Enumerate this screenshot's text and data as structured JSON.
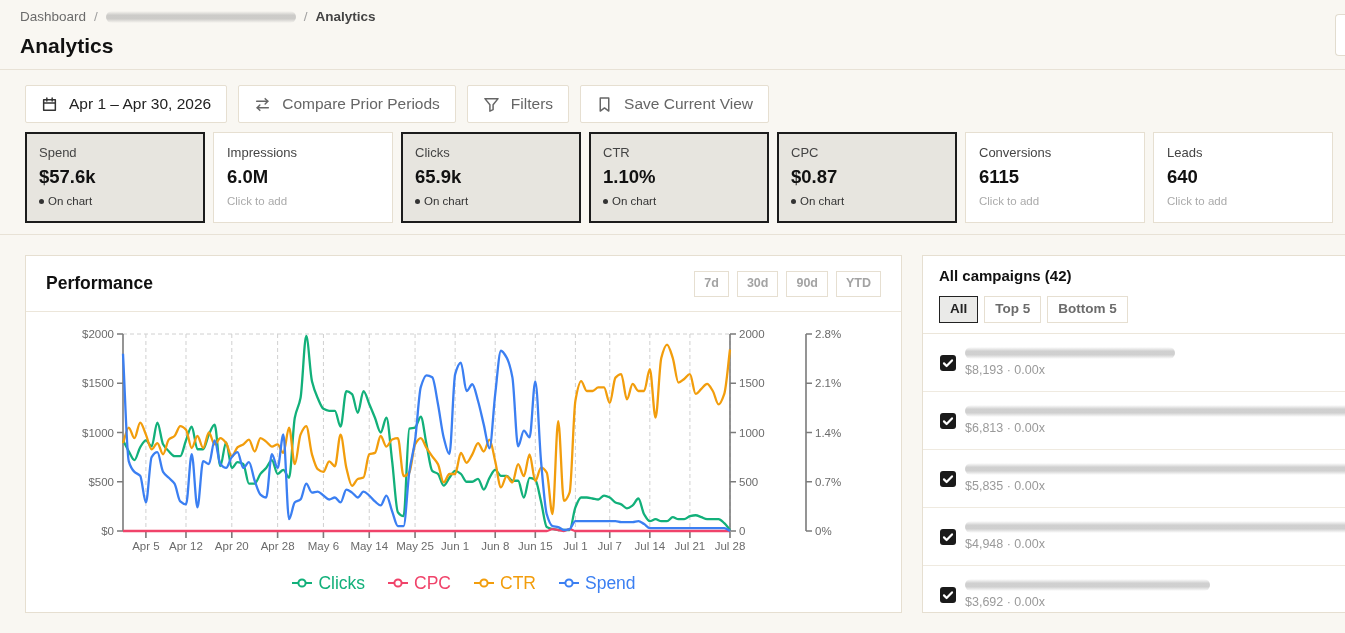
{
  "breadcrumb": [
    {
      "kind": "link",
      "label": "Dashboard"
    },
    {
      "kind": "separator",
      "label": "/"
    },
    {
      "kind": "blurred"
    },
    {
      "kind": "separator",
      "label": "/"
    },
    {
      "kind": "current",
      "label": "Analytics"
    }
  ],
  "page_title": "Analytics",
  "toolbar": [
    {
      "kind": "date",
      "label": "Apr 1 – Apr 30, 2026"
    },
    {
      "kind": "compare",
      "label": "Compare Prior Periods"
    },
    {
      "kind": "filter",
      "label": "Filters"
    },
    {
      "kind": "save",
      "label": "Save Current View"
    }
  ],
  "metrics": [
    {
      "label": "Spend",
      "value": "$57.6k",
      "selected": true,
      "note": "On chart"
    },
    {
      "label": "Impressions",
      "value": "6.0M",
      "selected": false,
      "note": "Click to add"
    },
    {
      "label": "Clicks",
      "value": "65.9k",
      "selected": true,
      "note": "On chart"
    },
    {
      "label": "CTR",
      "value": "1.10%",
      "selected": true,
      "note": "On chart"
    },
    {
      "label": "CPC",
      "value": "$0.87",
      "selected": true,
      "note": "On chart"
    },
    {
      "label": "Conversions",
      "value": "6115",
      "selected": false,
      "note": "Click to add"
    },
    {
      "label": "Leads",
      "value": "640",
      "selected": false,
      "note": "Click to add"
    }
  ],
  "performance": {
    "title": "Performance",
    "ranges": [
      {
        "label": "7d",
        "selected": false
      },
      {
        "label": "30d",
        "selected": false
      },
      {
        "label": "90d",
        "selected": false
      },
      {
        "label": "YTD",
        "selected": false
      }
    ],
    "chart_data": {
      "type": "line",
      "grid": "x",
      "legend": "bottom",
      "categories": [
        null,
        null,
        null,
        null,
        "Apr 5",
        null,
        null,
        null,
        null,
        null,
        null,
        "Apr 12",
        null,
        null,
        null,
        null,
        null,
        null,
        null,
        "Apr 20",
        null,
        null,
        null,
        null,
        null,
        null,
        null,
        "Apr 28",
        null,
        null,
        null,
        null,
        null,
        null,
        null,
        "May 6",
        null,
        null,
        null,
        null,
        null,
        null,
        null,
        "May 14",
        null,
        null,
        null,
        null,
        null,
        null,
        null,
        "May 25",
        null,
        null,
        null,
        null,
        null,
        null,
        "Jun 1",
        null,
        null,
        null,
        null,
        null,
        null,
        "Jun 8",
        null,
        null,
        null,
        null,
        null,
        null,
        "Jun 15",
        null,
        null,
        null,
        null,
        null,
        null,
        "Jul 1",
        null,
        null,
        null,
        null,
        null,
        "Jul 7",
        null,
        null,
        null,
        null,
        null,
        null,
        "Jul 14",
        null,
        null,
        null,
        null,
        null,
        null,
        "Jul 21",
        null,
        null,
        null,
        null,
        null,
        null,
        "Jul 28"
      ],
      "ylim": [
        0,
        2000
      ],
      "yticks": [
        {
          "value": 0,
          "label": "$0"
        },
        {
          "value": 500,
          "label": "$500"
        },
        {
          "value": 1000,
          "label": "$1000"
        },
        {
          "value": 1500,
          "label": "$1500"
        },
        {
          "value": 2000,
          "label": "$2000"
        }
      ],
      "y2lim": [
        0,
        2000
      ],
      "y2ticks": [
        {
          "value": 0,
          "label": "0"
        },
        {
          "value": 500,
          "label": "500"
        },
        {
          "value": 1000,
          "label": "1000"
        },
        {
          "value": 1500,
          "label": "1500"
        },
        {
          "value": 2000,
          "label": "2000"
        }
      ],
      "y3lim": [
        0,
        2.8
      ],
      "y3ticks": [
        {
          "value": 0,
          "label": "0%"
        },
        {
          "value": 0.7,
          "label": "0.7%"
        },
        {
          "value": 1.4,
          "label": "1.4%"
        },
        {
          "value": 2.1,
          "label": "2.1%"
        },
        {
          "value": 2.8,
          "label": "2.8%"
        }
      ],
      "series": [
        {
          "name": "Clicks",
          "color": "#12b07a",
          "axis": "y2",
          "values": [
            920,
            810,
            720,
            850,
            920,
            860,
            1100,
            880,
            810,
            760,
            760,
            920,
            1060,
            830,
            830,
            980,
            1080,
            660,
            900,
            640,
            700,
            680,
            480,
            480,
            580,
            640,
            720,
            580,
            620,
            540,
            1150,
            1350,
            1980,
            1520,
            1350,
            1240,
            1220,
            1220,
            1060,
            1420,
            1390,
            1200,
            1420,
            1290,
            1150,
            1000,
            1150,
            710,
            190,
            150,
            1040,
            1050,
            1160,
            880,
            610,
            580,
            460,
            540,
            610,
            580,
            500,
            500,
            530,
            420,
            540,
            620,
            560,
            560,
            510,
            510,
            340,
            540,
            520,
            300,
            40,
            20,
            10,
            10,
            10,
            240,
            340,
            340,
            330,
            320,
            360,
            340,
            290,
            270,
            230,
            260,
            330,
            170,
            100,
            120,
            100,
            100,
            140,
            120,
            120,
            150,
            160,
            140,
            120,
            120,
            120,
            80,
            10
          ]
        },
        {
          "name": "CPC",
          "color": "#f0436a",
          "axis": "y",
          "values": [
            0,
            0,
            0,
            0,
            0,
            0,
            0,
            0,
            0,
            0,
            0,
            0,
            0,
            0,
            0,
            0,
            0,
            0,
            0,
            0,
            0,
            0,
            0,
            0,
            0,
            0,
            0,
            0,
            0,
            0,
            0,
            0,
            0,
            0,
            0,
            0,
            0,
            0,
            0,
            0,
            0,
            0,
            0,
            0,
            0,
            0,
            0,
            0,
            0,
            0,
            0,
            0,
            0,
            0,
            0,
            0,
            0,
            0,
            0,
            0,
            0,
            0,
            0,
            0,
            0,
            0,
            0,
            0,
            0,
            0,
            0,
            0,
            0,
            0,
            0,
            20,
            10,
            0,
            20,
            0,
            0,
            0,
            0,
            0,
            0,
            0,
            0,
            0,
            0,
            0,
            0,
            0,
            0,
            0,
            0,
            0,
            0,
            0,
            0,
            0,
            0,
            0,
            0,
            0,
            0,
            0,
            0
          ]
        },
        {
          "name": "CTR",
          "color": "#f29d0c",
          "axis": "y3",
          "values": [
            1.25,
            1.47,
            1.32,
            1.54,
            1.37,
            1.16,
            1.25,
            1.09,
            1.3,
            1.35,
            1.49,
            1.44,
            1.18,
            1.35,
            1.18,
            1.4,
            1.23,
            1.32,
            1.25,
            1.06,
            1.19,
            1.23,
            1.3,
            1.13,
            1.32,
            1.27,
            1.2,
            1.23,
            1.11,
            1.47,
            0.95,
            1.37,
            1.49,
            1.09,
            0.88,
            0.84,
            0.99,
            0.92,
            1.37,
            0.9,
            0.64,
            0.74,
            0.76,
            1.09,
            1.11,
            1.35,
            1.2,
            1.3,
            1.32,
            0.78,
            0.83,
            1.23,
            1.32,
            1.18,
            1.06,
            0.95,
            0.69,
            0.81,
            0.81,
            1.11,
            0.97,
            1.09,
            1.25,
            1.13,
            1.3,
            0.99,
            0.62,
            0.78,
            0.69,
            0.95,
            0.78,
            1.09,
            0.71,
            0.9,
            0.83,
            0.24,
            1.56,
            0.43,
            0.55,
            1.85,
            2.13,
            1.99,
            1.99,
            2.04,
            2.04,
            1.82,
            2.18,
            2.23,
            1.87,
            2.09,
            1.99,
            1.99,
            2.3,
            1.61,
            2.46,
            2.65,
            2.46,
            2.11,
            2.16,
            2.23,
            1.95,
            2.02,
            2.09,
            1.99,
            1.8,
            1.95,
            2.58
          ]
        },
        {
          "name": "Spend",
          "color": "#3b7ff2",
          "axis": "y",
          "values": [
            1800,
            710,
            600,
            560,
            290,
            750,
            800,
            600,
            540,
            480,
            300,
            270,
            780,
            240,
            710,
            680,
            920,
            680,
            640,
            750,
            800,
            640,
            700,
            510,
            370,
            340,
            780,
            640,
            980,
            120,
            290,
            320,
            480,
            390,
            400,
            360,
            320,
            340,
            290,
            420,
            390,
            340,
            400,
            360,
            300,
            260,
            360,
            200,
            50,
            50,
            600,
            920,
            1460,
            1580,
            1560,
            1290,
            950,
            780,
            1590,
            1710,
            1420,
            1490,
            1320,
            1080,
            840,
            1390,
            1830,
            1760,
            1560,
            860,
            1020,
            950,
            1520,
            710,
            170,
            50,
            40,
            10,
            20,
            100,
            100,
            100,
            100,
            100,
            100,
            100,
            100,
            90,
            90,
            90,
            100,
            70,
            30,
            30,
            30,
            30,
            30,
            30,
            30,
            30,
            30,
            30,
            30,
            30,
            30,
            30,
            0
          ]
        }
      ]
    }
  },
  "campaigns": {
    "title": "All campaigns (42)",
    "filters": [
      {
        "label": "All",
        "selected": true
      },
      {
        "label": "Top 5",
        "selected": false
      },
      {
        "label": "Bottom 5",
        "selected": false
      }
    ],
    "rows": [
      {
        "checked": true,
        "stats": "$8,193 · 0.00x"
      },
      {
        "checked": true,
        "stats": "$6,813 · 0.00x"
      },
      {
        "checked": true,
        "stats": "$5,835 · 0.00x"
      },
      {
        "checked": true,
        "stats": "$4,948 · 0.00x"
      },
      {
        "checked": true,
        "stats": "$3,692 · 0.00x"
      }
    ]
  }
}
